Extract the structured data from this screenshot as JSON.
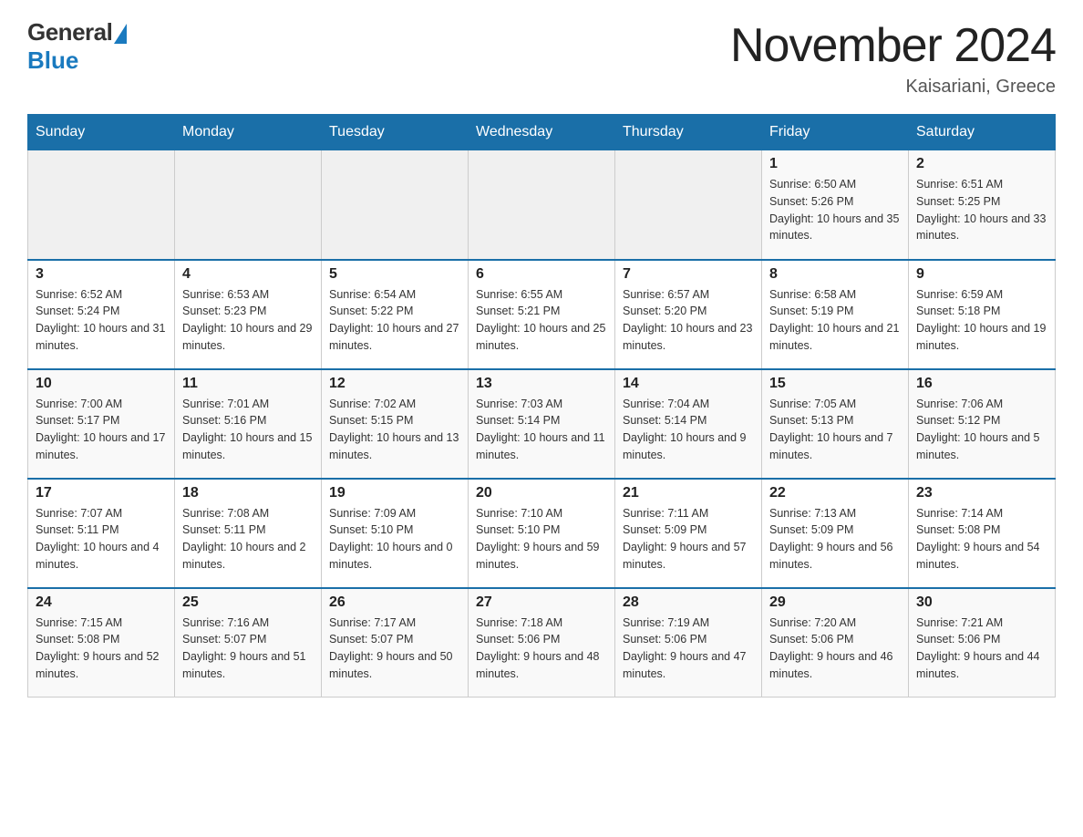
{
  "logo": {
    "general": "General",
    "blue": "Blue"
  },
  "title": "November 2024",
  "location": "Kaisariani, Greece",
  "days_of_week": [
    "Sunday",
    "Monday",
    "Tuesday",
    "Wednesday",
    "Thursday",
    "Friday",
    "Saturday"
  ],
  "weeks": [
    [
      {
        "day": "",
        "sunrise": "",
        "sunset": "",
        "daylight": ""
      },
      {
        "day": "",
        "sunrise": "",
        "sunset": "",
        "daylight": ""
      },
      {
        "day": "",
        "sunrise": "",
        "sunset": "",
        "daylight": ""
      },
      {
        "day": "",
        "sunrise": "",
        "sunset": "",
        "daylight": ""
      },
      {
        "day": "",
        "sunrise": "",
        "sunset": "",
        "daylight": ""
      },
      {
        "day": "1",
        "sunrise": "Sunrise: 6:50 AM",
        "sunset": "Sunset: 5:26 PM",
        "daylight": "Daylight: 10 hours and 35 minutes."
      },
      {
        "day": "2",
        "sunrise": "Sunrise: 6:51 AM",
        "sunset": "Sunset: 5:25 PM",
        "daylight": "Daylight: 10 hours and 33 minutes."
      }
    ],
    [
      {
        "day": "3",
        "sunrise": "Sunrise: 6:52 AM",
        "sunset": "Sunset: 5:24 PM",
        "daylight": "Daylight: 10 hours and 31 minutes."
      },
      {
        "day": "4",
        "sunrise": "Sunrise: 6:53 AM",
        "sunset": "Sunset: 5:23 PM",
        "daylight": "Daylight: 10 hours and 29 minutes."
      },
      {
        "day": "5",
        "sunrise": "Sunrise: 6:54 AM",
        "sunset": "Sunset: 5:22 PM",
        "daylight": "Daylight: 10 hours and 27 minutes."
      },
      {
        "day": "6",
        "sunrise": "Sunrise: 6:55 AM",
        "sunset": "Sunset: 5:21 PM",
        "daylight": "Daylight: 10 hours and 25 minutes."
      },
      {
        "day": "7",
        "sunrise": "Sunrise: 6:57 AM",
        "sunset": "Sunset: 5:20 PM",
        "daylight": "Daylight: 10 hours and 23 minutes."
      },
      {
        "day": "8",
        "sunrise": "Sunrise: 6:58 AM",
        "sunset": "Sunset: 5:19 PM",
        "daylight": "Daylight: 10 hours and 21 minutes."
      },
      {
        "day": "9",
        "sunrise": "Sunrise: 6:59 AM",
        "sunset": "Sunset: 5:18 PM",
        "daylight": "Daylight: 10 hours and 19 minutes."
      }
    ],
    [
      {
        "day": "10",
        "sunrise": "Sunrise: 7:00 AM",
        "sunset": "Sunset: 5:17 PM",
        "daylight": "Daylight: 10 hours and 17 minutes."
      },
      {
        "day": "11",
        "sunrise": "Sunrise: 7:01 AM",
        "sunset": "Sunset: 5:16 PM",
        "daylight": "Daylight: 10 hours and 15 minutes."
      },
      {
        "day": "12",
        "sunrise": "Sunrise: 7:02 AM",
        "sunset": "Sunset: 5:15 PM",
        "daylight": "Daylight: 10 hours and 13 minutes."
      },
      {
        "day": "13",
        "sunrise": "Sunrise: 7:03 AM",
        "sunset": "Sunset: 5:14 PM",
        "daylight": "Daylight: 10 hours and 11 minutes."
      },
      {
        "day": "14",
        "sunrise": "Sunrise: 7:04 AM",
        "sunset": "Sunset: 5:14 PM",
        "daylight": "Daylight: 10 hours and 9 minutes."
      },
      {
        "day": "15",
        "sunrise": "Sunrise: 7:05 AM",
        "sunset": "Sunset: 5:13 PM",
        "daylight": "Daylight: 10 hours and 7 minutes."
      },
      {
        "day": "16",
        "sunrise": "Sunrise: 7:06 AM",
        "sunset": "Sunset: 5:12 PM",
        "daylight": "Daylight: 10 hours and 5 minutes."
      }
    ],
    [
      {
        "day": "17",
        "sunrise": "Sunrise: 7:07 AM",
        "sunset": "Sunset: 5:11 PM",
        "daylight": "Daylight: 10 hours and 4 minutes."
      },
      {
        "day": "18",
        "sunrise": "Sunrise: 7:08 AM",
        "sunset": "Sunset: 5:11 PM",
        "daylight": "Daylight: 10 hours and 2 minutes."
      },
      {
        "day": "19",
        "sunrise": "Sunrise: 7:09 AM",
        "sunset": "Sunset: 5:10 PM",
        "daylight": "Daylight: 10 hours and 0 minutes."
      },
      {
        "day": "20",
        "sunrise": "Sunrise: 7:10 AM",
        "sunset": "Sunset: 5:10 PM",
        "daylight": "Daylight: 9 hours and 59 minutes."
      },
      {
        "day": "21",
        "sunrise": "Sunrise: 7:11 AM",
        "sunset": "Sunset: 5:09 PM",
        "daylight": "Daylight: 9 hours and 57 minutes."
      },
      {
        "day": "22",
        "sunrise": "Sunrise: 7:13 AM",
        "sunset": "Sunset: 5:09 PM",
        "daylight": "Daylight: 9 hours and 56 minutes."
      },
      {
        "day": "23",
        "sunrise": "Sunrise: 7:14 AM",
        "sunset": "Sunset: 5:08 PM",
        "daylight": "Daylight: 9 hours and 54 minutes."
      }
    ],
    [
      {
        "day": "24",
        "sunrise": "Sunrise: 7:15 AM",
        "sunset": "Sunset: 5:08 PM",
        "daylight": "Daylight: 9 hours and 52 minutes."
      },
      {
        "day": "25",
        "sunrise": "Sunrise: 7:16 AM",
        "sunset": "Sunset: 5:07 PM",
        "daylight": "Daylight: 9 hours and 51 minutes."
      },
      {
        "day": "26",
        "sunrise": "Sunrise: 7:17 AM",
        "sunset": "Sunset: 5:07 PM",
        "daylight": "Daylight: 9 hours and 50 minutes."
      },
      {
        "day": "27",
        "sunrise": "Sunrise: 7:18 AM",
        "sunset": "Sunset: 5:06 PM",
        "daylight": "Daylight: 9 hours and 48 minutes."
      },
      {
        "day": "28",
        "sunrise": "Sunrise: 7:19 AM",
        "sunset": "Sunset: 5:06 PM",
        "daylight": "Daylight: 9 hours and 47 minutes."
      },
      {
        "day": "29",
        "sunrise": "Sunrise: 7:20 AM",
        "sunset": "Sunset: 5:06 PM",
        "daylight": "Daylight: 9 hours and 46 minutes."
      },
      {
        "day": "30",
        "sunrise": "Sunrise: 7:21 AM",
        "sunset": "Sunset: 5:06 PM",
        "daylight": "Daylight: 9 hours and 44 minutes."
      }
    ]
  ]
}
